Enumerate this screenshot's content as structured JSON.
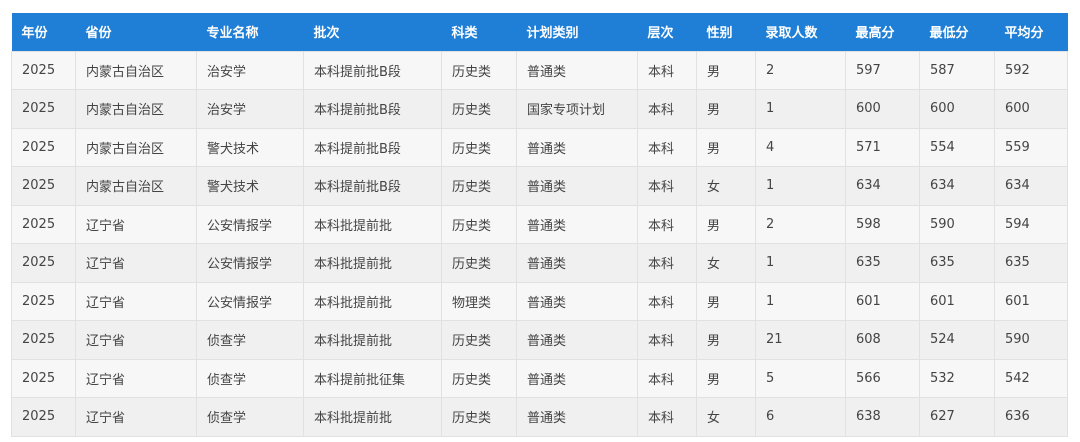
{
  "table": {
    "columns": [
      "年份",
      "省份",
      "专业名称",
      "批次",
      "科类",
      "计划类别",
      "层次",
      "性别",
      "录取人数",
      "最高分",
      "最低分",
      "平均分"
    ],
    "rows": [
      [
        "2025",
        "内蒙古自治区",
        "治安学",
        "本科提前批B段",
        "历史类",
        "普通类",
        "本科",
        "男",
        "2",
        "597",
        "587",
        "592"
      ],
      [
        "2025",
        "内蒙古自治区",
        "治安学",
        "本科提前批B段",
        "历史类",
        "国家专项计划",
        "本科",
        "男",
        "1",
        "600",
        "600",
        "600"
      ],
      [
        "2025",
        "内蒙古自治区",
        "警犬技术",
        "本科提前批B段",
        "历史类",
        "普通类",
        "本科",
        "男",
        "4",
        "571",
        "554",
        "559"
      ],
      [
        "2025",
        "内蒙古自治区",
        "警犬技术",
        "本科提前批B段",
        "历史类",
        "普通类",
        "本科",
        "女",
        "1",
        "634",
        "634",
        "634"
      ],
      [
        "2025",
        "辽宁省",
        "公安情报学",
        "本科批提前批",
        "历史类",
        "普通类",
        "本科",
        "男",
        "2",
        "598",
        "590",
        "594"
      ],
      [
        "2025",
        "辽宁省",
        "公安情报学",
        "本科批提前批",
        "历史类",
        "普通类",
        "本科",
        "女",
        "1",
        "635",
        "635",
        "635"
      ],
      [
        "2025",
        "辽宁省",
        "公安情报学",
        "本科批提前批",
        "物理类",
        "普通类",
        "本科",
        "男",
        "1",
        "601",
        "601",
        "601"
      ],
      [
        "2025",
        "辽宁省",
        "侦查学",
        "本科批提前批",
        "历史类",
        "普通类",
        "本科",
        "男",
        "21",
        "608",
        "524",
        "590"
      ],
      [
        "2025",
        "辽宁省",
        "侦查学",
        "本科提前批征集",
        "历史类",
        "普通类",
        "本科",
        "男",
        "5",
        "566",
        "532",
        "542"
      ],
      [
        "2025",
        "辽宁省",
        "侦查学",
        "本科批提前批",
        "历史类",
        "普通类",
        "本科",
        "女",
        "6",
        "638",
        "627",
        "636"
      ]
    ]
  },
  "colors": {
    "header_bg": "#1f7fd6",
    "header_text": "#ffffff",
    "row_odd": "#f7f7f7",
    "row_even": "#f0f0f0",
    "cell_border": "#e1e1e1",
    "cell_text": "#444444"
  }
}
